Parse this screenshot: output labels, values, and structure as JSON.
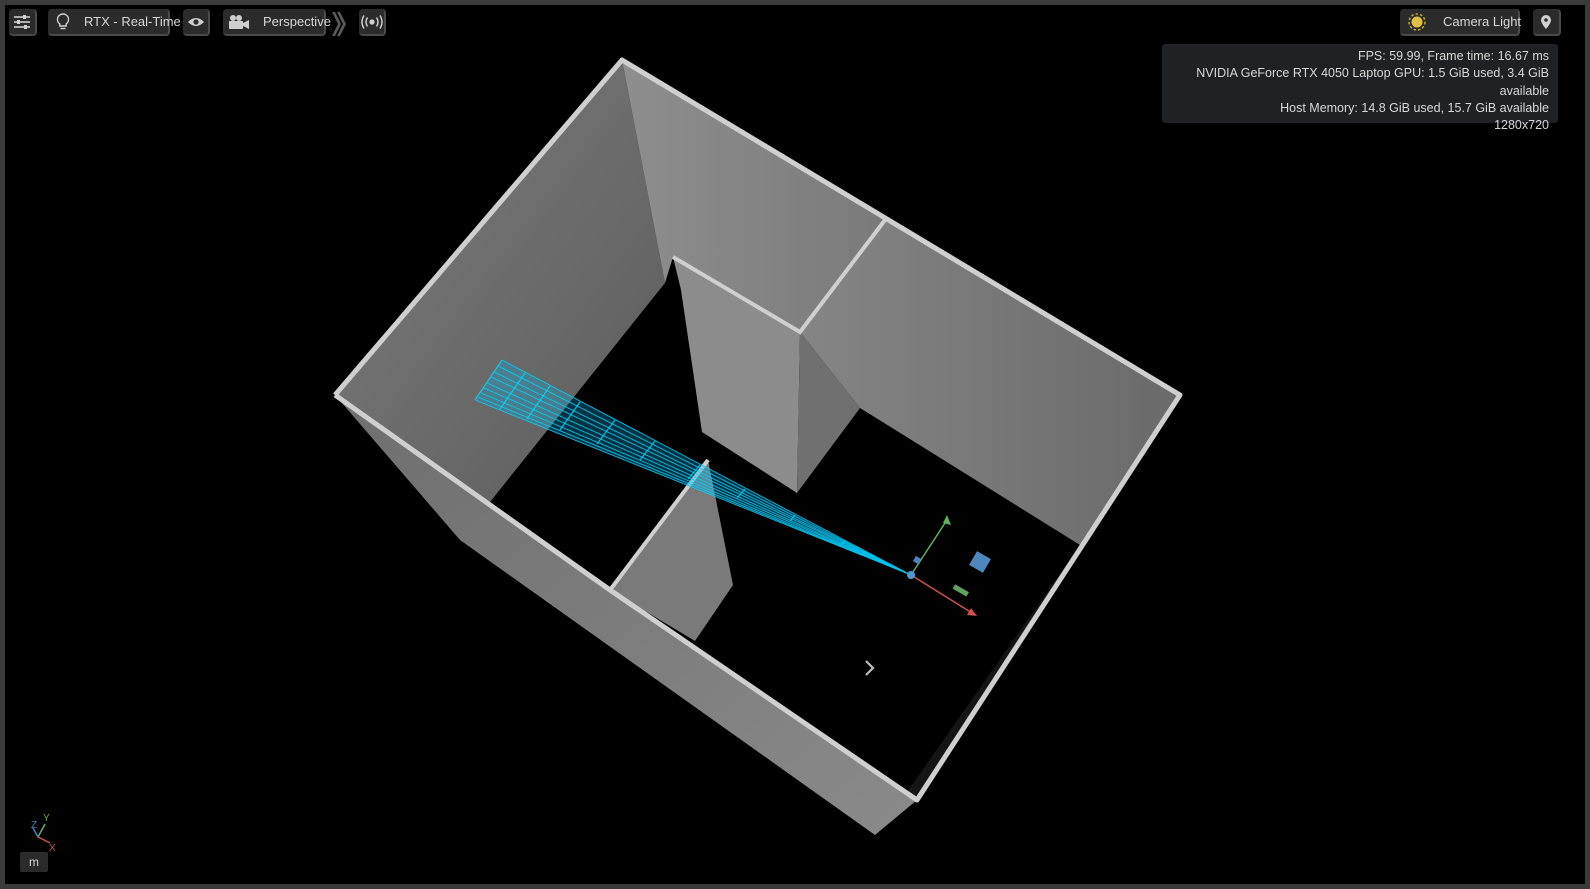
{
  "toolbar": {
    "settings_icon": "sliders-icon",
    "renderer_icon": "lightbulb-icon",
    "renderer_label": "RTX - Real-Time",
    "visibility_icon": "eye-icon",
    "camera_icon": "camera-icon",
    "camera_label": "Perspective",
    "expand_icon": "chevron-double-right-icon",
    "stream_icon": "broadcast-icon",
    "light_icon": "sun-icon",
    "light_label": "Camera Light",
    "pin_icon": "map-pin-icon"
  },
  "stats": {
    "fps": "FPS: 59.99, Frame time: 16.67 ms",
    "gpu": "NVIDIA GeForce RTX 4050 Laptop GPU: 1.5 GiB used, 3.4 GiB available",
    "host_memory": "Host Memory: 14.8 GiB used, 15.7 GiB available",
    "resolution": "1280x720"
  },
  "axis": {
    "y": "Y",
    "z": "Z",
    "x": "X"
  },
  "units": "m",
  "colors": {
    "lidar": "#00c8ff",
    "wall": "#8a8a8a",
    "wall_top": "#c8c8c8",
    "gizmo_x": "#d05050",
    "gizmo_y": "#60b060",
    "gizmo_z": "#4a80c0"
  }
}
